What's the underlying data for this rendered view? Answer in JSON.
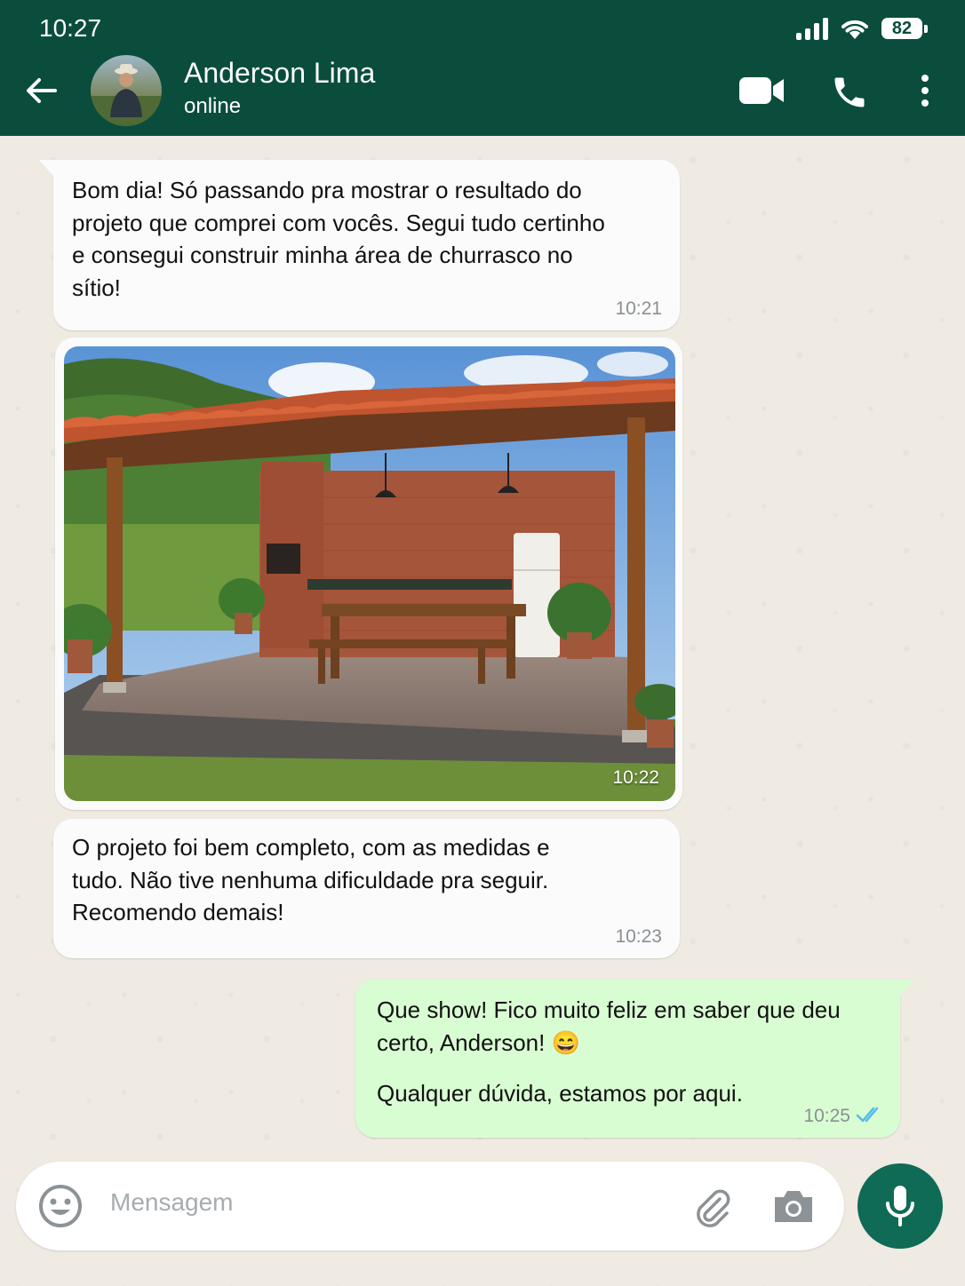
{
  "status_bar": {
    "time": "10:27",
    "battery": "82"
  },
  "header": {
    "contact_name": "Anderson Lima",
    "contact_status": "online"
  },
  "messages": [
    {
      "direction": "in",
      "text": "Bom dia! Só passando pra mostrar o resultado do projeto que comprei com vocês. Segui tudo certinho e consegui construir minha área de churrasco no sítio!",
      "time": "10:21"
    },
    {
      "direction": "in",
      "type": "image",
      "time": "10:22"
    },
    {
      "direction": "in",
      "text": "O projeto foi bem completo,  com as medidas e tudo. Não tive nenhuma dificuldade pra seguir. Recomendo demais!",
      "time": "10:23"
    },
    {
      "direction": "out",
      "text_line1": "Que show! Fico muito feliz em saber que deu certo, Anderson! 😄",
      "text_line2": "Qualquer dúvida, estamos por aqui.",
      "time": "10:25",
      "status": "read"
    }
  ],
  "composer": {
    "placeholder": "Mensagem"
  },
  "colors": {
    "header": "#0a4d3c",
    "outgoing_bubble": "#d9fdd3",
    "read_ticks": "#53bdeb",
    "mic_button": "#0f6b55"
  }
}
